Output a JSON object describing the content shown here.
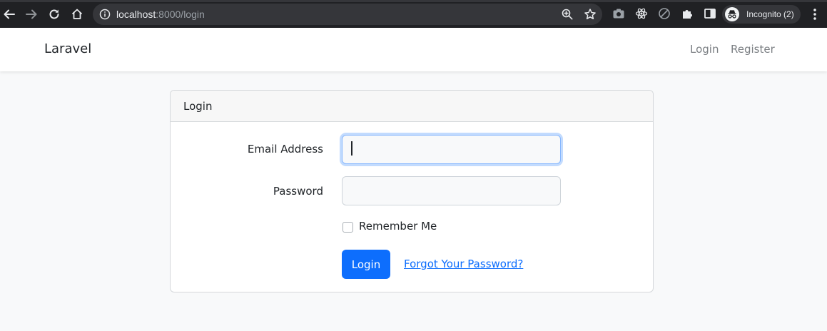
{
  "browser": {
    "url_host": "localhost",
    "url_path": ":8000/login",
    "profile_label": "Incognito (2)"
  },
  "navbar": {
    "brand": "Laravel",
    "links": [
      "Login",
      "Register"
    ]
  },
  "card": {
    "title": "Login",
    "email_label": "Email Address",
    "email_value": "",
    "password_label": "Password",
    "password_value": "",
    "remember_label": "Remember Me",
    "remember_checked": false,
    "submit_label": "Login",
    "forgot_link": "Forgot Your Password?"
  },
  "colors": {
    "primary": "#0d6efd",
    "page_background": "#f8f9fa",
    "chrome_background": "#202124"
  }
}
